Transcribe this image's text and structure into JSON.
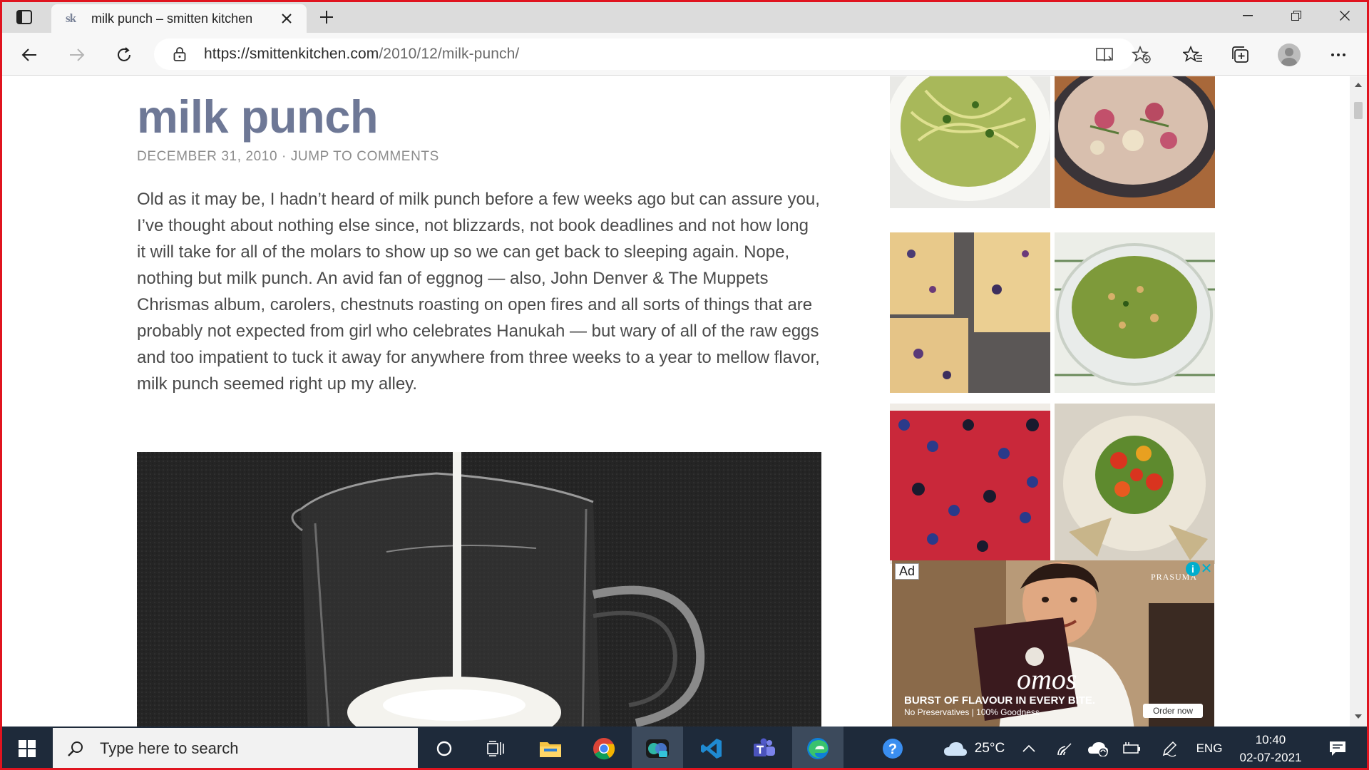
{
  "browser": {
    "tab_title": "milk punch – smitten kitchen",
    "favicon_text": "sk",
    "url_host": "https://smittenkitchen.com",
    "url_path": "/2010/12/milk-punch/"
  },
  "post": {
    "title": "milk punch",
    "date": "DECEMBER 31, 2010",
    "separator": " · ",
    "jump_link": "JUMP TO COMMENTS",
    "body": "Old as it may be, I hadn’t heard of milk punch before a few weeks ago but can assure you, I’ve thought about nothing else since, not blizzards, not book deadlines and not how long it will take for all of the molars to show up so we can get back to sleeping again. Nope, nothing but milk punch. An avid fan of eggnog — also, John Denver & The Muppets Chrismas album, carolers, chestnuts roasting on open fires and all sorts of things that are probably not expected from girl who celebrates Hanukah — but wary of all of the raw eggs and too impatient to tuck it away for anywhere from three weeks to a year to mellow flavor, milk punch seemed right up my alley."
  },
  "ad": {
    "label": "Ad",
    "info": "i",
    "close": "✕",
    "brand": "PRASUMA",
    "headline": "BURST OF FLAVOUR IN EVERY BITE.",
    "subline": "No Preservatives | 100% Goodness",
    "cta": "Order now"
  },
  "taskbar": {
    "search_placeholder": "Type here to search",
    "temperature": "25°C",
    "language": "ENG",
    "time": "10:40",
    "date": "02-07-2021"
  },
  "colors": {
    "frame": "#e0141f",
    "title": "#6e7896",
    "taskbar": "#1e2a3a"
  }
}
